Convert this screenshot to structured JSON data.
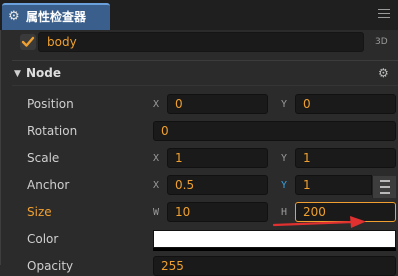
{
  "window": {
    "tab_title": "属性检查器",
    "tab_icon": "gear-icon",
    "menu_icon": "hamburger-menu-icon"
  },
  "node_header": {
    "enabled": true,
    "name": "body",
    "mode_button": "3D"
  },
  "section": {
    "arrow": "▼",
    "title": "Node",
    "gear": "⚙"
  },
  "properties": {
    "position": {
      "label": "Position",
      "x_axis": "X",
      "x": "0",
      "y_axis": "Y",
      "y": "0"
    },
    "rotation": {
      "label": "Rotation",
      "value": "0"
    },
    "scale": {
      "label": "Scale",
      "x_axis": "X",
      "x": "1",
      "y_axis": "Y",
      "y": "1"
    },
    "anchor": {
      "label": "Anchor",
      "x_axis": "X",
      "x": "0.5",
      "y_axis": "Y",
      "y": "1"
    },
    "size": {
      "label": "Size",
      "w_axis": "W",
      "w": "10",
      "h_axis": "H",
      "h": "200"
    },
    "color": {
      "label": "Color",
      "value": "#ffffff"
    },
    "opacity": {
      "label": "Opacity",
      "value": "255"
    }
  },
  "colors": {
    "accent": "#f0a030",
    "tab_active": "#3a5f8c",
    "focus_axis": "#3aa0e0",
    "annotation_arrow": "#e03030"
  }
}
